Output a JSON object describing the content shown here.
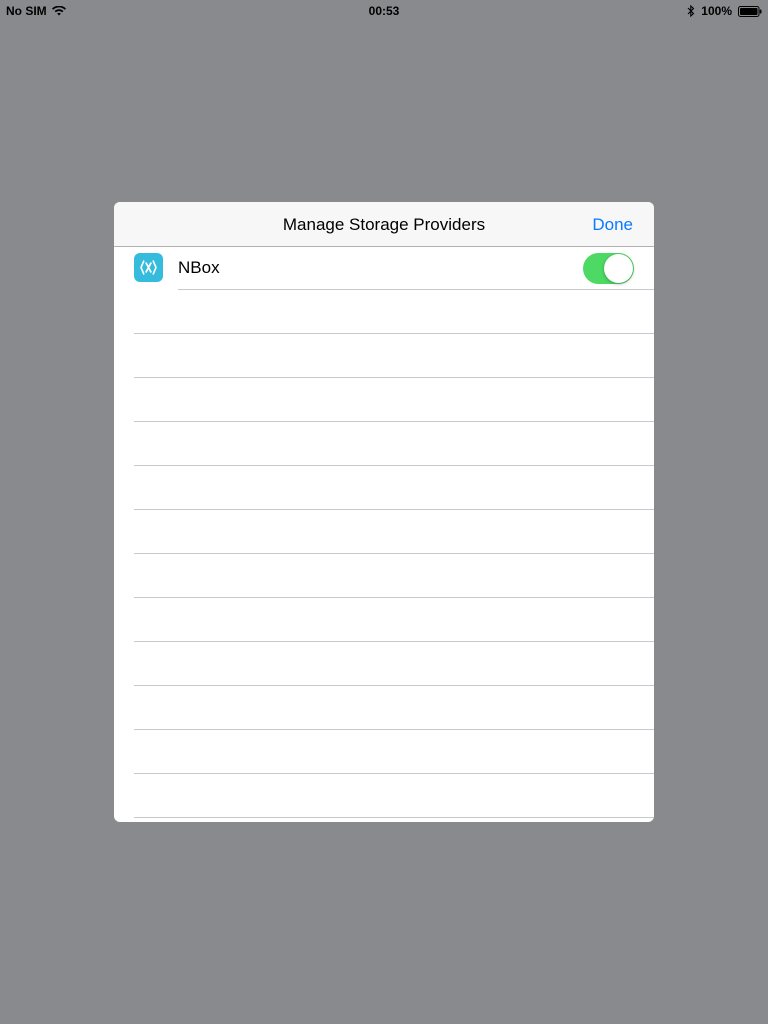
{
  "status_bar": {
    "carrier": "No SIM",
    "time": "00:53",
    "battery_percent": "100%",
    "icons": [
      "wifi-icon",
      "bluetooth-icon",
      "battery-icon"
    ]
  },
  "modal": {
    "title": "Manage Storage Providers",
    "done_label": "Done",
    "providers": [
      {
        "name": "NBox",
        "icon": "xamarin-logo-icon",
        "enabled": true
      }
    ],
    "empty_rows": 12
  },
  "colors": {
    "backdrop": "#898a8e",
    "accent": "#0a7aff",
    "toggle_on": "#4cd964",
    "app_icon_bg": "#35bbdc"
  }
}
